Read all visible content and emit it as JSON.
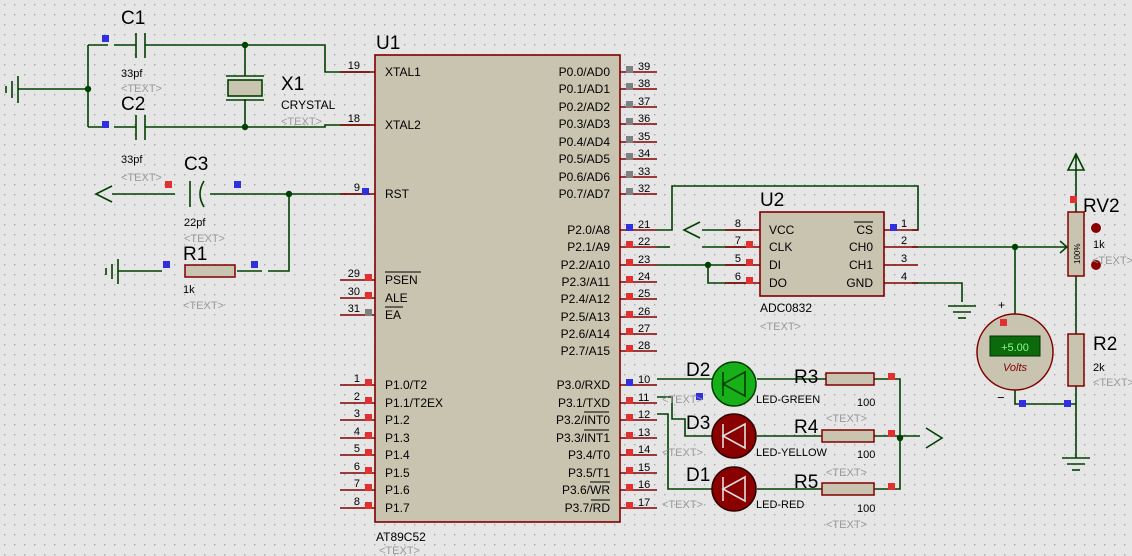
{
  "colors": {
    "background": "#e6e6e6",
    "grid": "#a8a8a8",
    "wire": "#004000",
    "body_fill": "#c8c4b0",
    "body_stroke": "#800000",
    "pin_red": "#e03030",
    "pin_blue": "#3030e0",
    "pin_gray": "#808080",
    "led_green": "#18b018",
    "led_red": "#8a0000",
    "meter_display": "#0c6a0c"
  },
  "u1": {
    "ref": "U1",
    "part": "AT89C52",
    "text": "<TEXT>",
    "left_pins": [
      {
        "num": "19",
        "name": "XTAL1"
      },
      {
        "num": "18",
        "name": "XTAL2"
      },
      {
        "num": "9",
        "name": "RST"
      },
      {
        "num": "29",
        "name": "PSEN"
      },
      {
        "num": "30",
        "name": "ALE"
      },
      {
        "num": "31",
        "name": "EA"
      },
      {
        "num": "1",
        "name": "P1.0/T2"
      },
      {
        "num": "2",
        "name": "P1.1/T2EX"
      },
      {
        "num": "3",
        "name": "P1.2"
      },
      {
        "num": "4",
        "name": "P1.3"
      },
      {
        "num": "5",
        "name": "P1.4"
      },
      {
        "num": "6",
        "name": "P1.5"
      },
      {
        "num": "7",
        "name": "P1.6"
      },
      {
        "num": "8",
        "name": "P1.7"
      }
    ],
    "right_pins": [
      {
        "num": "39",
        "name": "P0.0/AD0"
      },
      {
        "num": "38",
        "name": "P0.1/AD1"
      },
      {
        "num": "37",
        "name": "P0.2/AD2"
      },
      {
        "num": "36",
        "name": "P0.3/AD3"
      },
      {
        "num": "35",
        "name": "P0.4/AD4"
      },
      {
        "num": "34",
        "name": "P0.5/AD5"
      },
      {
        "num": "33",
        "name": "P0.6/AD6"
      },
      {
        "num": "32",
        "name": "P0.7/AD7"
      },
      {
        "num": "21",
        "name": "P2.0/A8"
      },
      {
        "num": "22",
        "name": "P2.1/A9"
      },
      {
        "num": "23",
        "name": "P2.2/A10"
      },
      {
        "num": "24",
        "name": "P2.3/A11"
      },
      {
        "num": "25",
        "name": "P2.4/A12"
      },
      {
        "num": "26",
        "name": "P2.5/A13"
      },
      {
        "num": "27",
        "name": "P2.6/A14"
      },
      {
        "num": "28",
        "name": "P2.7/A15"
      },
      {
        "num": "10",
        "name": "P3.0/RXD"
      },
      {
        "num": "11",
        "name": "P3.1/TXD"
      },
      {
        "num": "12",
        "name": "P3.2/INT0"
      },
      {
        "num": "13",
        "name": "P3.3/INT1"
      },
      {
        "num": "14",
        "name": "P3.4/T0"
      },
      {
        "num": "15",
        "name": "P3.5/T1"
      },
      {
        "num": "16",
        "name": "P3.6/WR"
      },
      {
        "num": "17",
        "name": "P3.7/RD"
      }
    ]
  },
  "u2": {
    "ref": "U2",
    "part": "ADC0832",
    "text": "<TEXT>",
    "left_pins": [
      {
        "num": "8",
        "name": "VCC"
      },
      {
        "num": "7",
        "name": "CLK"
      },
      {
        "num": "5",
        "name": "DI"
      },
      {
        "num": "6",
        "name": "DO"
      }
    ],
    "right_pins": [
      {
        "num": "1",
        "name": "CS"
      },
      {
        "num": "2",
        "name": "CH0"
      },
      {
        "num": "3",
        "name": "CH1"
      },
      {
        "num": "4",
        "name": "GND"
      }
    ]
  },
  "c1": {
    "ref": "C1",
    "value": "33pf",
    "text": "<TEXT>"
  },
  "c2": {
    "ref": "C2",
    "value": "33pf",
    "text": "<TEXT>"
  },
  "c3": {
    "ref": "C3",
    "value": "22pf",
    "text": "<TEXT>"
  },
  "x1": {
    "ref": "X1",
    "value": "CRYSTAL",
    "text": "<TEXT>"
  },
  "r1": {
    "ref": "R1",
    "value": "1k",
    "text": "<TEXT>"
  },
  "r2": {
    "ref": "R2",
    "value": "2k",
    "text": "<TEXT>"
  },
  "r3": {
    "ref": "R3",
    "value": "100",
    "text": "<TEXT>"
  },
  "r4": {
    "ref": "R4",
    "value": "100",
    "text": "<TEXT>"
  },
  "r5": {
    "ref": "R5",
    "value": "100",
    "text": "<TEXT>"
  },
  "rv2": {
    "ref": "RV2",
    "value": "1k",
    "percent": "100%",
    "text": "<TEXT>"
  },
  "d2": {
    "ref": "D2",
    "value": "LED-GREEN",
    "text": "<TEXT>"
  },
  "d3": {
    "ref": "D3",
    "value": "LED-YELLOW",
    "text": "<TEXT>"
  },
  "d1": {
    "ref": "D1",
    "value": "LED-RED",
    "text": "<TEXT>"
  },
  "voltmeter": {
    "reading": "+5.00",
    "unit": "Volts",
    "plus": "+",
    "minus": "−"
  }
}
